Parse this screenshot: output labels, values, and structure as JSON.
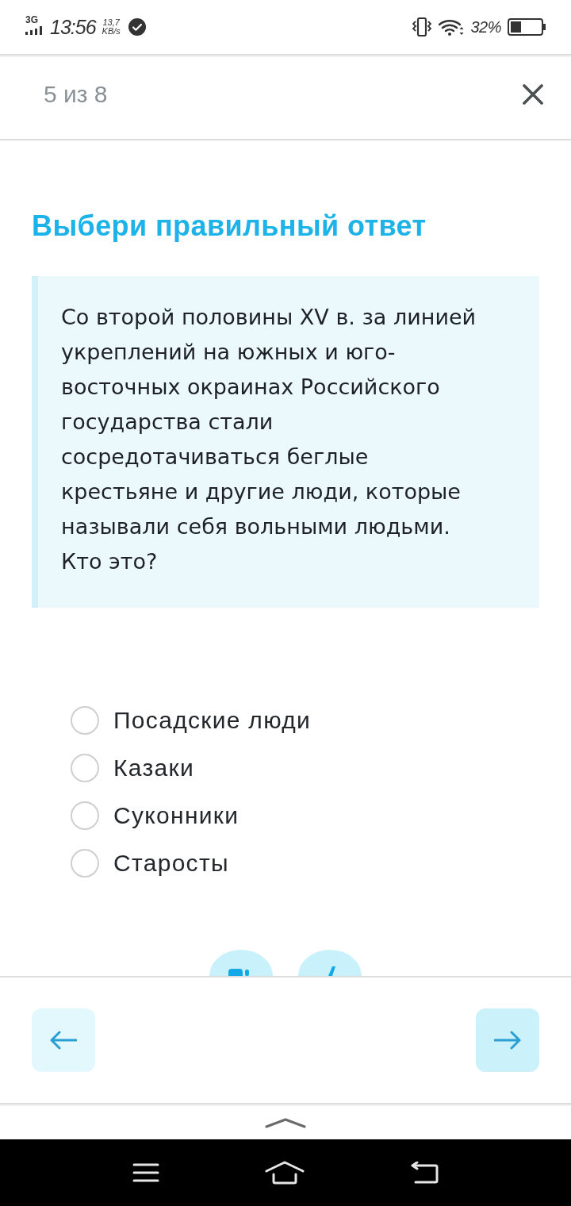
{
  "status_bar": {
    "network": "3G",
    "time": "13:56",
    "speed": "13,7",
    "speed_unit": "KB/s",
    "battery": "32%"
  },
  "header": {
    "progress": "5 из 8"
  },
  "task": {
    "title": "Выбери правильный ответ",
    "question": "Со второй половины XV в. за линией укреплений на южных и юго-восточных окраинах Российского государства стали сосредотачиваться беглые крестьяне и другие люди, которые называли себя вольными людьми. Кто это?"
  },
  "options": [
    {
      "label": "Посадские люди",
      "selected": false
    },
    {
      "label": "Казаки",
      "selected": false
    },
    {
      "label": "Суконники",
      "selected": false
    },
    {
      "label": "Старосты",
      "selected": false
    }
  ]
}
